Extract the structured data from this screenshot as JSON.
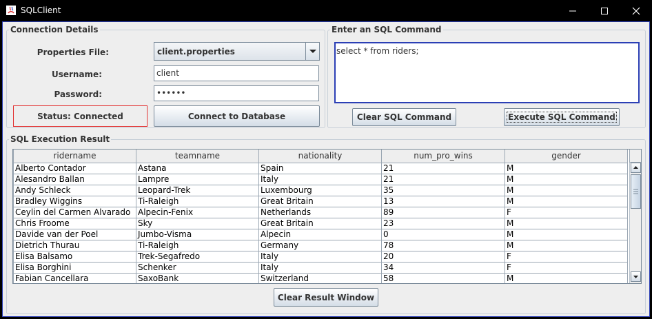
{
  "window": {
    "title": "SQLClient"
  },
  "connection": {
    "group_title": "Connection Details",
    "properties_label": "Properties File:",
    "properties_value": "client.properties",
    "username_label": "Username:",
    "username_value": "client",
    "password_label": "Password:",
    "password_value": "••••••",
    "status_text": "Status: Connected",
    "connect_button": "Connect to Database"
  },
  "sql": {
    "group_title": "Enter an SQL Command",
    "command_text": "select * from riders;",
    "clear_button": "Clear SQL Command",
    "execute_button": "Execute SQL Command"
  },
  "result": {
    "group_title": "SQL Execution Result",
    "columns": [
      "ridername",
      "teamname",
      "nationality",
      "num_pro_wins",
      "gender"
    ],
    "rows": [
      [
        "Alberto Contador",
        "Astana",
        "Spain",
        "21",
        "M"
      ],
      [
        "Alesandro Ballan",
        "Lampre",
        "Italy",
        "21",
        "M"
      ],
      [
        "Andy Schleck",
        "Leopard-Trek",
        "Luxembourg",
        "35",
        "M"
      ],
      [
        "Bradley Wiggins",
        "Ti-Raleigh",
        "Great Britain",
        "13",
        "M"
      ],
      [
        "Ceylin del Carmen Alvarado",
        "Alpecin-Fenix",
        "Netherlands",
        "89",
        "F"
      ],
      [
        "Chris Froome",
        "Sky",
        "Great Britain",
        "23",
        "M"
      ],
      [
        "Davide van der Poel",
        "Jumbo-Visma",
        "Alpecin",
        "0",
        "M"
      ],
      [
        "Dietrich Thurau",
        "Ti-Raleigh",
        "Germany",
        "78",
        "M"
      ],
      [
        "Elisa Balsamo",
        "Trek-Segafredo",
        "Italy",
        "20",
        "F"
      ],
      [
        "Elisa Borghini",
        "Schenker",
        "Italy",
        "34",
        "F"
      ],
      [
        "Fabian Cancellara",
        "SaxoBank",
        "Switzerland",
        "58",
        "M"
      ]
    ],
    "clear_button": "Clear Result Window"
  },
  "colors": {
    "accent_border": "#2b3fb5",
    "status_border": "#e23131"
  }
}
